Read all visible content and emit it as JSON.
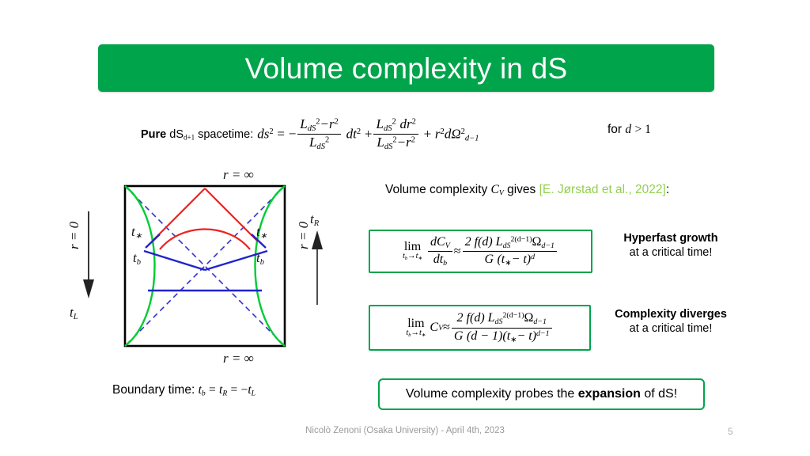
{
  "slide": {
    "title": "Volume complexity in dS",
    "banner_color": "#00A44B"
  },
  "metric": {
    "label_bold": "Pure",
    "label_rest": " dS",
    "label_sub": "d+1",
    "label_tail": " spacetime:",
    "ds2": "ds",
    "ds2_sup": "2",
    "equals": "=",
    "minus": "−",
    "num1": "L",
    "num1_sub": "dS",
    "num1_sup": "2",
    "num1_minus_r": "−r",
    "num1_r_sup": "2",
    "den1": "L",
    "den1_sub": "dS",
    "den1_sup": "2",
    "dt2": "dt",
    "dt2_sup": "2",
    "plus": "+",
    "num2": "L",
    "num2_sub": "dS",
    "num2_sup": "2",
    "num2_dr": "dr",
    "num2_dr_sup": "2",
    "den2": "L",
    "den2_sub": "dS",
    "den2_sup": "2",
    "den2_minus_r": "−r",
    "den2_r_sup": "2",
    "r2": "r",
    "r2_sup": "2",
    "domega": "dΩ",
    "domega_sup": "2",
    "domega_sub": "d−1",
    "condition": "for",
    "condition_var": "d",
    "condition_rel": "> 1"
  },
  "diagram": {
    "label_r_infinity_top": "r = ∞",
    "label_r_infinity_bottom": "r = ∞",
    "label_r_zero_left": "r = 0",
    "label_r_zero_right": "r = 0",
    "label_t_L": "t",
    "label_t_L_sub": "L",
    "label_t_R": "t",
    "label_t_R_sub": "R",
    "label_t_star_left": "t",
    "label_t_star_left_sub": "∗",
    "label_t_star_right": "t",
    "label_t_star_right_sub": "∗",
    "label_t_b_left": "t",
    "label_t_b_left_sub": "b",
    "label_t_b_right": "t",
    "label_t_b_right_sub": "b",
    "colors": {
      "boundary": "#000000",
      "horizon_dashed": "#3333cc",
      "r_zero_curve": "#00cc33",
      "extremal_blue": "#2222cc",
      "extremal_red": "#ee2222"
    }
  },
  "boundary_time": {
    "prefix": "Boundary time:",
    "tb": "t",
    "tb_sub": "b",
    "eq1": "=",
    "tR": "t",
    "tR_sub": "R",
    "eq2": "=",
    "minus": "−",
    "tL": "t",
    "tL_sub": "L"
  },
  "volume_complexity": {
    "prefix": "Volume complexity",
    "symbol": "C",
    "symbol_sub": "V",
    "gives": "gives",
    "citation": "[E. Jørstad et al., 2022]",
    "colon": ":",
    "citation_color": "#92D050"
  },
  "formula1": {
    "lim_top": "lim",
    "lim_bot_tb": "t",
    "lim_bot_tb_sub": "b",
    "lim_bot_arrow": "→",
    "lim_bot_tstar": "t",
    "lim_bot_tstar_sub": "∗",
    "lhs_num_d": "d",
    "lhs_num_C": "C",
    "lhs_num_C_sub": "V",
    "lhs_den_d": "dt",
    "lhs_den_sub": "b",
    "approx": "≈",
    "rhs_num": "2 f(d) L",
    "rhs_num_L_sub": "dS",
    "rhs_num_L_sup": "2(d−1)",
    "rhs_num_omega": "Ω",
    "rhs_num_omega_sub": "d−1",
    "rhs_den_G": "G",
    "rhs_den_paren": "(t",
    "rhs_den_star": "∗",
    "rhs_den_minus_t": "− t)",
    "rhs_den_sup": "d"
  },
  "formula2": {
    "lim_top": "lim",
    "lim_bot_tb": "t",
    "lim_bot_tb_sub": "b",
    "lim_bot_arrow": "→",
    "lim_bot_tstar": "t",
    "lim_bot_tstar_sub": "∗",
    "lhs_C": "C",
    "lhs_C_sub": "V",
    "approx": "≈",
    "rhs_num": "2 f(d) L",
    "rhs_num_L_sub": "dS",
    "rhs_num_L_sup": "2(d−1)",
    "rhs_num_omega": "Ω",
    "rhs_num_omega_sub": "d−1",
    "rhs_den_G": "G",
    "rhs_den_d1": "(d − 1)(t",
    "rhs_den_star": "∗",
    "rhs_den_minus_t": "− t)",
    "rhs_den_sup": "d−1"
  },
  "note1": {
    "bold": "Hyperfast growth",
    "regular": "at a critical time!"
  },
  "note2": {
    "bold": "Complexity diverges",
    "regular": "at a critical time!"
  },
  "conclusion": {
    "part1": "Volume complexity probes the ",
    "bold": "expansion",
    "part2": " of dS!",
    "border_color": "#00A44B"
  },
  "footer": {
    "text": "Nicolò Zenoni (Osaka University) - April 4th, 2023",
    "page_number": "5"
  }
}
